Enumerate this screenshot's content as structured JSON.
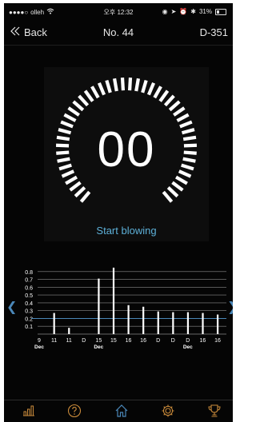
{
  "status_bar": {
    "carrier": "olleh",
    "time": "오후 12:32",
    "battery": "31%"
  },
  "nav": {
    "back_label": "Back",
    "title": "No. 44",
    "device_id": "D-351"
  },
  "gauge": {
    "value": "00",
    "status_text": "Start blowing",
    "level": 0
  },
  "chart_data": {
    "type": "bar",
    "categories": [
      "9",
      "11",
      "11",
      "D",
      "15",
      "15",
      "16",
      "16",
      "D",
      "D",
      "D",
      "16",
      "16"
    ],
    "subcategories": [
      "Dec",
      "",
      "",
      "",
      "Dec",
      "",
      "",
      "",
      "",
      "",
      "Dec",
      "",
      ""
    ],
    "values": [
      0,
      0.27,
      0.08,
      0,
      0.71,
      0.85,
      0.37,
      0.35,
      0.29,
      0.28,
      0.28,
      0.27,
      0.25
    ],
    "ylim": [
      0,
      0.9
    ],
    "yticks": [
      "0.8",
      "0.7",
      "0.6",
      "0.5",
      "0.4",
      "0.3",
      "0.2",
      "0.1"
    ],
    "threshold": 0.2,
    "grid": true,
    "colors": {
      "bar": "#ffffff",
      "grid": "#8a8a8a",
      "threshold": "#4a87b8"
    }
  },
  "tabs": [
    {
      "name": "stats",
      "icon": "bar-chart-icon"
    },
    {
      "name": "help",
      "icon": "question-icon"
    },
    {
      "name": "home",
      "icon": "home-icon",
      "active": true
    },
    {
      "name": "settings",
      "icon": "gear-icon"
    },
    {
      "name": "ranking",
      "icon": "trophy-icon"
    }
  ],
  "colors": {
    "accent": "#5db0d8",
    "background": "#050505"
  }
}
